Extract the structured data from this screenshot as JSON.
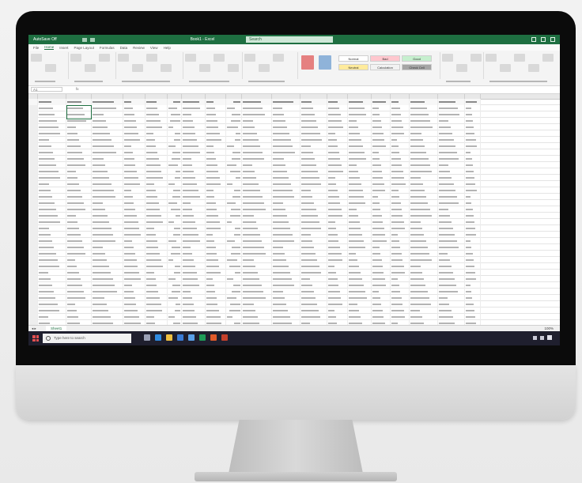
{
  "titlebar": {
    "autosave_label": "AutoSave  Off",
    "document_title": "Book1 - Excel",
    "search_placeholder": "Search"
  },
  "ribbon_tabs": [
    "File",
    "Home",
    "Insert",
    "Page Layout",
    "Formulas",
    "Data",
    "Review",
    "View",
    "Help"
  ],
  "ribbon": {
    "styles": [
      {
        "label": "Normal",
        "color": "#ffffff"
      },
      {
        "label": "Bad",
        "color": "#ffc7ce"
      },
      {
        "label": "Good",
        "color": "#c6efce"
      },
      {
        "label": "Neutral",
        "color": "#ffeb9c"
      },
      {
        "label": "Calculation",
        "color": "#f2f2f2"
      },
      {
        "label": "Check Cell",
        "color": "#a5a5a5"
      }
    ]
  },
  "formula_bar": {
    "name_box": "A1",
    "fx": "fx"
  },
  "sheet": {
    "tab_name": "Sheet1",
    "zoom": "100%"
  },
  "taskbar": {
    "search_placeholder": "Type here to search",
    "icons": [
      {
        "name": "task-view-icon",
        "color": "#9aa0b5"
      },
      {
        "name": "edge-icon",
        "color": "#2f8be0"
      },
      {
        "name": "file-explorer-icon",
        "color": "#f0c040"
      },
      {
        "name": "store-icon",
        "color": "#3a7bd5"
      },
      {
        "name": "mail-icon",
        "color": "#5aa0e8"
      },
      {
        "name": "excel-icon",
        "color": "#1e9b57"
      },
      {
        "name": "office-icon",
        "color": "#e05a2a"
      },
      {
        "name": "powerpoint-icon",
        "color": "#c4402b"
      }
    ]
  },
  "colors": {
    "excel_green": "#1e6f41",
    "bezel": "#0b0b0b",
    "taskbar": "#1f1f2e"
  }
}
